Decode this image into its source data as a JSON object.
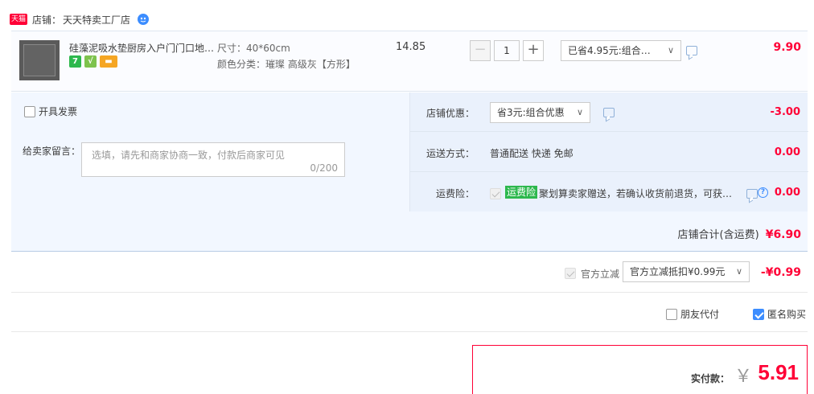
{
  "shop": {
    "badge": "天猫",
    "label": "店铺：",
    "name": "天天特卖工厂店"
  },
  "item": {
    "title": "硅藻泥吸水垫厨房入户门门口地…",
    "size": "尺寸：40*60cm",
    "color": "颜色分类：璀璨 高级灰【方形】",
    "unit_price": "14.85",
    "quantity": "1",
    "qty_minus": "−",
    "qty_plus": "+",
    "discount_select": "已省4.95元:组合…",
    "total": "9.90",
    "service_icons": [
      "7",
      "√",
      "▬"
    ]
  },
  "order": {
    "invoice_label": "开具发票",
    "memo_label": "给卖家留言：",
    "memo_placeholder": "选填，请先和商家协商一致，付款后商家可见",
    "memo_count": "0/200",
    "shop_discount_label": "店铺优惠：",
    "shop_discount_select": "省3元:组合优惠",
    "shop_discount_value": "-3.00",
    "shipping_label": "运送方式：",
    "shipping_text": "普通配送 快递 免邮",
    "shipping_value": "0.00",
    "insurance_label": "运费险：",
    "insurance_badge": "运费险",
    "insurance_text": "聚划算卖家赠送，若确认收货前退货，可获…",
    "insurance_value": "0.00",
    "shop_total_label": "店铺合计(含运费)",
    "shop_total_value": "¥6.90"
  },
  "official": {
    "label": "官方立减",
    "select": "官方立减抵扣¥0.99元",
    "value": "-¥0.99"
  },
  "options": {
    "friend_pay": "朋友代付",
    "anonymous": "匿名购买",
    "anonymous_checked": true
  },
  "payment": {
    "label": "实付款：",
    "yen": "￥",
    "amount": "5.91"
  },
  "colors": {
    "accent_red": "#ff0036",
    "panel_bg": "#f2f7ff",
    "check_blue": "#3c8dff",
    "badge_green": "#2db84d"
  }
}
